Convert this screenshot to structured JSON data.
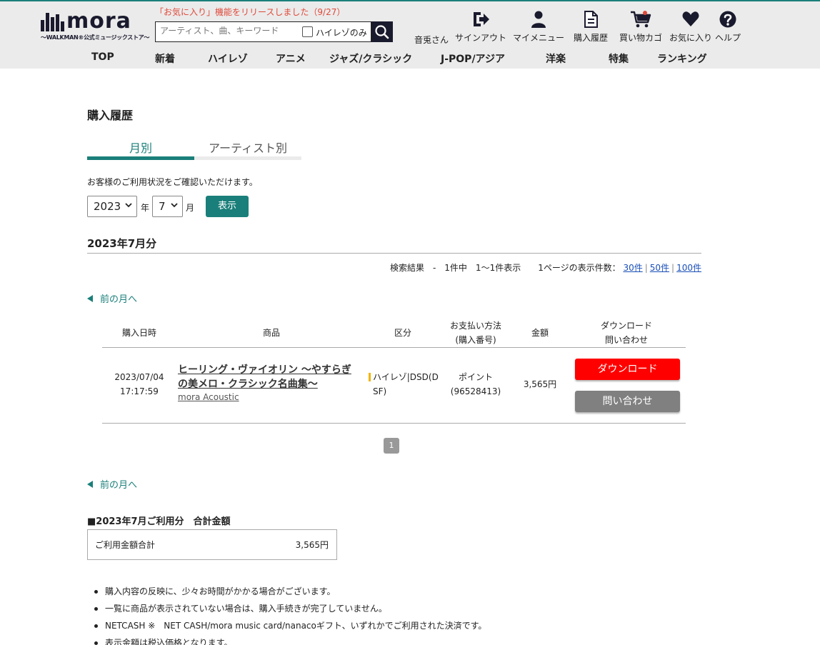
{
  "header": {
    "logo_text": "mora",
    "logo_sub": "〜WALKMAN®公式ミュージックストア〜",
    "notice": "「お気に入り」機能をリリースしました（9/27）",
    "search": {
      "placeholder": "アーティスト、曲、キーワード",
      "hires_label": "ハイレゾのみ"
    },
    "user_name": "音兎さん",
    "nav": [
      {
        "label": "サインアウト",
        "icon": "sign-out-icon"
      },
      {
        "label": "マイメニュー",
        "icon": "user-icon"
      },
      {
        "label": "購入履歴",
        "icon": "document-icon"
      },
      {
        "label": "買い物カゴ",
        "icon": "cart-icon"
      },
      {
        "label": "お気に入り",
        "icon": "heart-icon"
      },
      {
        "label": "ヘルプ",
        "icon": "help-icon"
      }
    ],
    "genres": [
      "TOP",
      "新着",
      "ハイレゾ",
      "アニメ",
      "ジャズ/クラシック",
      "J-POP/アジア",
      "洋楽",
      "特集",
      "ランキング"
    ]
  },
  "main": {
    "title": "購入履歴",
    "tabs": [
      "月別",
      "アーティスト別"
    ],
    "intro": "お客様のご利用状況をご確認いただけます。",
    "year": "2023",
    "year_unit": "年",
    "month": "7",
    "month_unit": "月",
    "show_button": "表示",
    "month_heading": "2023年7月分",
    "result": {
      "summary": "検索結果　-　1件中　1〜1件表示　　1ページの表示件数：",
      "per_page": [
        "30件",
        "50件",
        "100件"
      ]
    },
    "prev_month": "前の月へ",
    "table": {
      "headers": {
        "date": "購入日時",
        "product": "商品",
        "category": "区分",
        "payment_1": "お支払い方法",
        "payment_2": "(購入番号)",
        "amount": "金額",
        "dl_1": "ダウンロード",
        "dl_2": "問い合わせ"
      },
      "rows": [
        {
          "date": "2023/07/04",
          "time": "17:17:59",
          "title_1": "ヒーリング・ヴァイオリン 〜やすらぎ",
          "title_2": "の美メロ・クラシック名曲集〜",
          "artist": "mora Acoustic",
          "category_1": "ハイレゾ|DSD(D",
          "category_2": "SF)",
          "payment": "ポイント",
          "purchase_no": "(96528413)",
          "amount": "3,565円",
          "download": "ダウンロード",
          "inquiry": "問い合わせ"
        }
      ]
    },
    "page": "1",
    "total": {
      "heading": "■2023年7月ご利用分　合計金額",
      "label": "ご利用金額合計",
      "value": "3,565円"
    },
    "notes": [
      "購入内容の反映に、少々お時間がかかる場合がございます。",
      "一覧に商品が表示されていない場合は、購入手続きが完了していません。",
      "NETCASH ※　NET CASH/mora music card/nanacoギフト、いずれかでご利用された決済です。",
      "表示金額は税込価格となります。"
    ]
  },
  "colors": {
    "accent": "#1a7f7a",
    "download": "#ff0000",
    "inquiry": "#808080",
    "notice": "#e04a3a",
    "link": "#1a4fb8"
  }
}
